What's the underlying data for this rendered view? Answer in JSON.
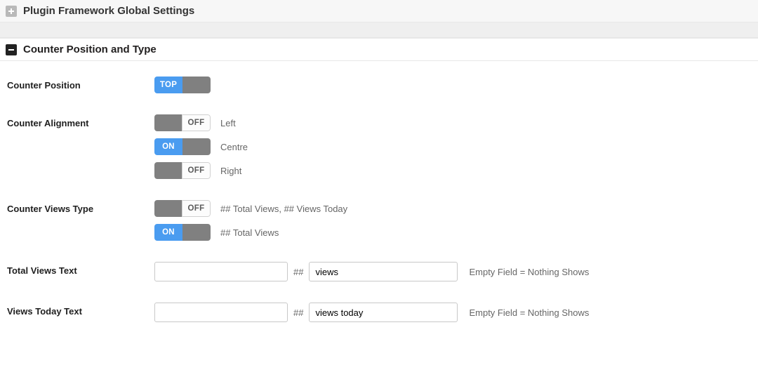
{
  "panels": {
    "global": {
      "title": "Plugin Framework Global Settings"
    },
    "position": {
      "title": "Counter Position and Type"
    }
  },
  "fields": {
    "counter_position": {
      "label": "Counter Position",
      "value": "TOP"
    },
    "counter_alignment": {
      "label": "Counter Alignment",
      "options": [
        {
          "state": "off",
          "text": "OFF",
          "label": "Left"
        },
        {
          "state": "on",
          "text": "ON",
          "label": "Centre"
        },
        {
          "state": "off",
          "text": "OFF",
          "label": "Right"
        }
      ]
    },
    "counter_views_type": {
      "label": "Counter Views Type",
      "options": [
        {
          "state": "off",
          "text": "OFF",
          "label": "## Total Views, ## Views Today"
        },
        {
          "state": "on",
          "text": "ON",
          "label": "## Total Views"
        }
      ]
    },
    "total_views_text": {
      "label": "Total Views Text",
      "before_value": "",
      "sep": "##",
      "after_value": "views",
      "hint": "Empty Field = Nothing Shows"
    },
    "views_today_text": {
      "label": "Views Today Text",
      "before_value": "",
      "sep": "##",
      "after_value": "views today",
      "hint": "Empty Field = Nothing Shows"
    }
  }
}
